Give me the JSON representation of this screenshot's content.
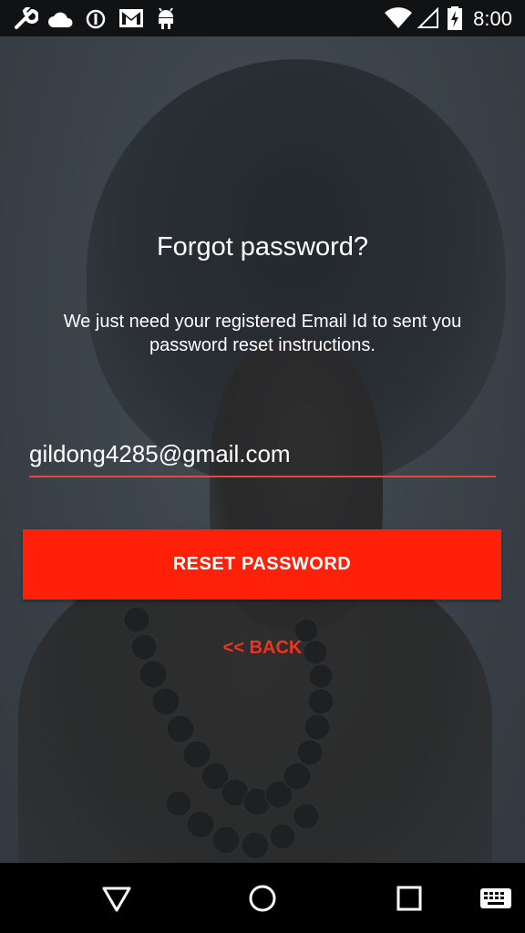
{
  "status_bar": {
    "time": "8:00",
    "icons": [
      "wrench-icon",
      "cloud-icon",
      "alert-icon",
      "gmail-icon",
      "android-icon",
      "wifi-icon",
      "signal-icon",
      "battery-icon"
    ]
  },
  "screen": {
    "title": "Forgot password?",
    "description": "We just need your registered Email Id to sent you password reset instructions.",
    "email_value": "gildong4285@gmail.com",
    "reset_button_label": "RESET PASSWORD",
    "back_link_label": "<< BACK"
  },
  "nav_bar": {
    "buttons": [
      "back-triangle-icon",
      "home-circle-icon",
      "recents-square-icon",
      "keyboard-icon"
    ]
  },
  "colors": {
    "accent": "#ff200a",
    "link": "#f0331f",
    "underline": "#e8453c"
  }
}
